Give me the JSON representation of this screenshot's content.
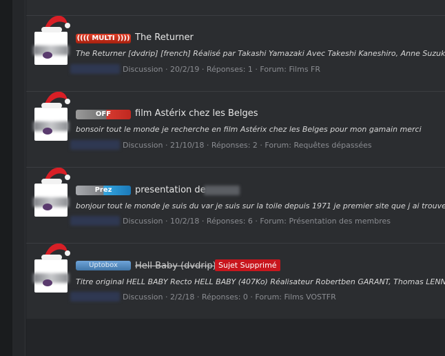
{
  "topics": [
    {
      "prefix_label": "(((( MULTI ))))",
      "prefix_style": "multi",
      "title": "The Returner",
      "struck": false,
      "deleted_label": "",
      "snippet": "The Returner [dvdrip] [french] Réalisé par Takashi Yamazaki Avec Takeshi Kaneshiro, Anne Suzuki, Goro",
      "meta": "Discussion · 20/2/19 · Réponses: 1 · Forum: Films FR"
    },
    {
      "prefix_label": "OFF",
      "prefix_style": "off",
      "title": "film Astérix chez les Belges",
      "struck": false,
      "deleted_label": "",
      "snippet": "bonsoir tout le monde je recherche en film Astérix chez les Belges pour mon gamain merci",
      "meta": "Discussion · 21/10/18 · Réponses: 2 · Forum: Requêtes dépassées"
    },
    {
      "prefix_label": "Prez",
      "prefix_style": "prez",
      "title": "presentation de",
      "struck": false,
      "deleted_label": "",
      "snippet": "bonjour tout le monde je suis du var je suis sur la toile depuis 1971 je premier site que j ai trouver était Se",
      "meta": "Discussion · 10/2/18 · Réponses: 6 · Forum: Présentation des membres"
    },
    {
      "prefix_label": "Uptobox",
      "prefix_style": "upto",
      "title": "Hell Baby (dvdrip)",
      "struck": true,
      "deleted_label": "Sujet Supprimé",
      "snippet": "Titre original HELL BABY Recto HELL BABY (407Ko) Réalisateur Robertben GARANT, Thomas LENNON A",
      "meta": "Discussion · 2/2/18 · Réponses: 0 · Forum: Films VOSTFR"
    }
  ]
}
